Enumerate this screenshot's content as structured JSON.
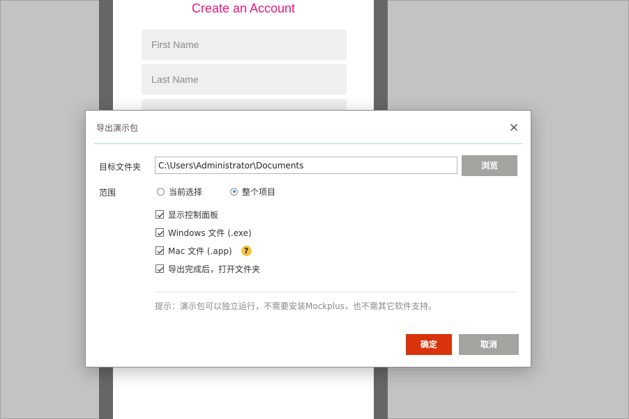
{
  "background_app": {
    "title": "Create an Account",
    "fields": [
      {
        "placeholder": "First Name"
      },
      {
        "placeholder": "Last Name"
      }
    ]
  },
  "dialog": {
    "title": "导出演示包",
    "close_icon": "close-icon",
    "target_folder_label": "目标文件夹",
    "target_folder_value": "C:\\Users\\Administrator\\Documents",
    "browse_label": "浏览",
    "scope_label": "范围",
    "scope_options": [
      {
        "label": "当前选择",
        "selected": false
      },
      {
        "label": "整个项目",
        "selected": true
      }
    ],
    "options": [
      {
        "label": "显示控制面板",
        "checked": true
      },
      {
        "label": "Windows 文件 (.exe)",
        "checked": true
      },
      {
        "label": "Mac 文件 (.app)",
        "checked": true,
        "help": "?"
      },
      {
        "label": "导出完成后，打开文件夹",
        "checked": true
      }
    ],
    "hint": "提示：演示包可以独立运行，不需要安装Mockplus，也不需其它软件支持。",
    "ok_label": "确定",
    "cancel_label": "取消"
  },
  "colors": {
    "accent_pink": "#e5197d",
    "ok_button": "#d8330a",
    "gray_button": "#a3a3a0",
    "help_icon": "#f3c33c",
    "title_separator": "#a9d8ee"
  }
}
